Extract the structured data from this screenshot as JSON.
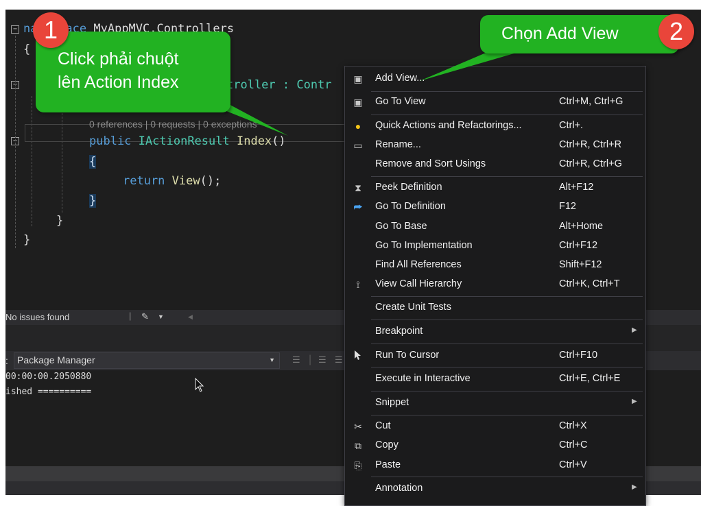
{
  "editor": {
    "line_namespace_kw": "namespace",
    "line_namespace_name": "MyAppMVC.Controllers",
    "open_brace": "{",
    "line_class_rest": "troller : ",
    "line_class_base": "Contr",
    "codelens": "0 references | 0 requests | 0 exceptions",
    "method_kw": "public",
    "method_type": "IActionResult",
    "method_name": "Index",
    "method_parens": "()",
    "method_open": "{",
    "return_kw": "return",
    "return_fn": "View",
    "return_rest": "();",
    "method_close": "}",
    "class_close": "}",
    "ns_close": "}"
  },
  "status": {
    "issues": "No issues found"
  },
  "package_manager": {
    "prefix": ":",
    "source_label": "Package Manager"
  },
  "output": {
    "line1": "00:00:00.2050880",
    "line2": "ished =========="
  },
  "context_menu": {
    "items": [
      {
        "label": "Add View...",
        "shortcut": "",
        "icon": "add-view-icon",
        "glyph": "▣"
      },
      {
        "label": "Go To View",
        "shortcut": "Ctrl+M, Ctrl+G",
        "icon": "go-to-view-icon",
        "glyph": "▣"
      },
      {
        "label": "Quick Actions and Refactorings...",
        "shortcut": "Ctrl+.",
        "icon": "lightbulb-icon",
        "glyph": "💡"
      },
      {
        "label": "Rename...",
        "shortcut": "Ctrl+R, Ctrl+R",
        "icon": "rename-icon",
        "glyph": "▭"
      },
      {
        "label": "Remove and Sort Usings",
        "shortcut": "Ctrl+R, Ctrl+G",
        "icon": "",
        "glyph": ""
      },
      {
        "label": "Peek Definition",
        "shortcut": "Alt+F12",
        "icon": "peek-definition-icon",
        "glyph": "⧗"
      },
      {
        "label": "Go To Definition",
        "shortcut": "F12",
        "icon": "go-to-definition-icon",
        "glyph": "⮫"
      },
      {
        "label": "Go To Base",
        "shortcut": "Alt+Home",
        "icon": "",
        "glyph": ""
      },
      {
        "label": "Go To Implementation",
        "shortcut": "Ctrl+F12",
        "icon": "",
        "glyph": ""
      },
      {
        "label": "Find All References",
        "shortcut": "Shift+F12",
        "icon": "",
        "glyph": ""
      },
      {
        "label": "View Call Hierarchy",
        "shortcut": "Ctrl+K, Ctrl+T",
        "icon": "call-hierarchy-icon",
        "glyph": "⟟"
      },
      {
        "label": "Create Unit Tests",
        "shortcut": "",
        "icon": "",
        "glyph": ""
      },
      {
        "label": "Breakpoint",
        "shortcut": "",
        "icon": "",
        "glyph": ""
      },
      {
        "label": "Run To Cursor",
        "shortcut": "Ctrl+F10",
        "icon": "cursor-arrow-icon",
        "glyph": "➤"
      },
      {
        "label": "Execute in Interactive",
        "shortcut": "Ctrl+E, Ctrl+E",
        "icon": "",
        "glyph": ""
      },
      {
        "label": "Snippet",
        "shortcut": "",
        "icon": "",
        "glyph": ""
      },
      {
        "label": "Cut",
        "shortcut": "Ctrl+X",
        "icon": "scissors-icon",
        "glyph": "✂"
      },
      {
        "label": "Copy",
        "shortcut": "Ctrl+C",
        "icon": "copy-icon",
        "glyph": "⧉"
      },
      {
        "label": "Paste",
        "shortcut": "Ctrl+V",
        "icon": "paste-icon",
        "glyph": "📋"
      },
      {
        "label": "Annotation",
        "shortcut": "",
        "icon": "",
        "glyph": ""
      }
    ]
  },
  "callouts": {
    "step1_number": "1",
    "step1_text_line1": "Click phải chuột",
    "step1_text_line2": "lên Action Index",
    "step2_number": "2",
    "step2_text": "Chọn Add View"
  },
  "colors": {
    "callout_green": "#22b222",
    "badge_red": "#e9453a",
    "editor_bg": "#1e1e1e"
  }
}
